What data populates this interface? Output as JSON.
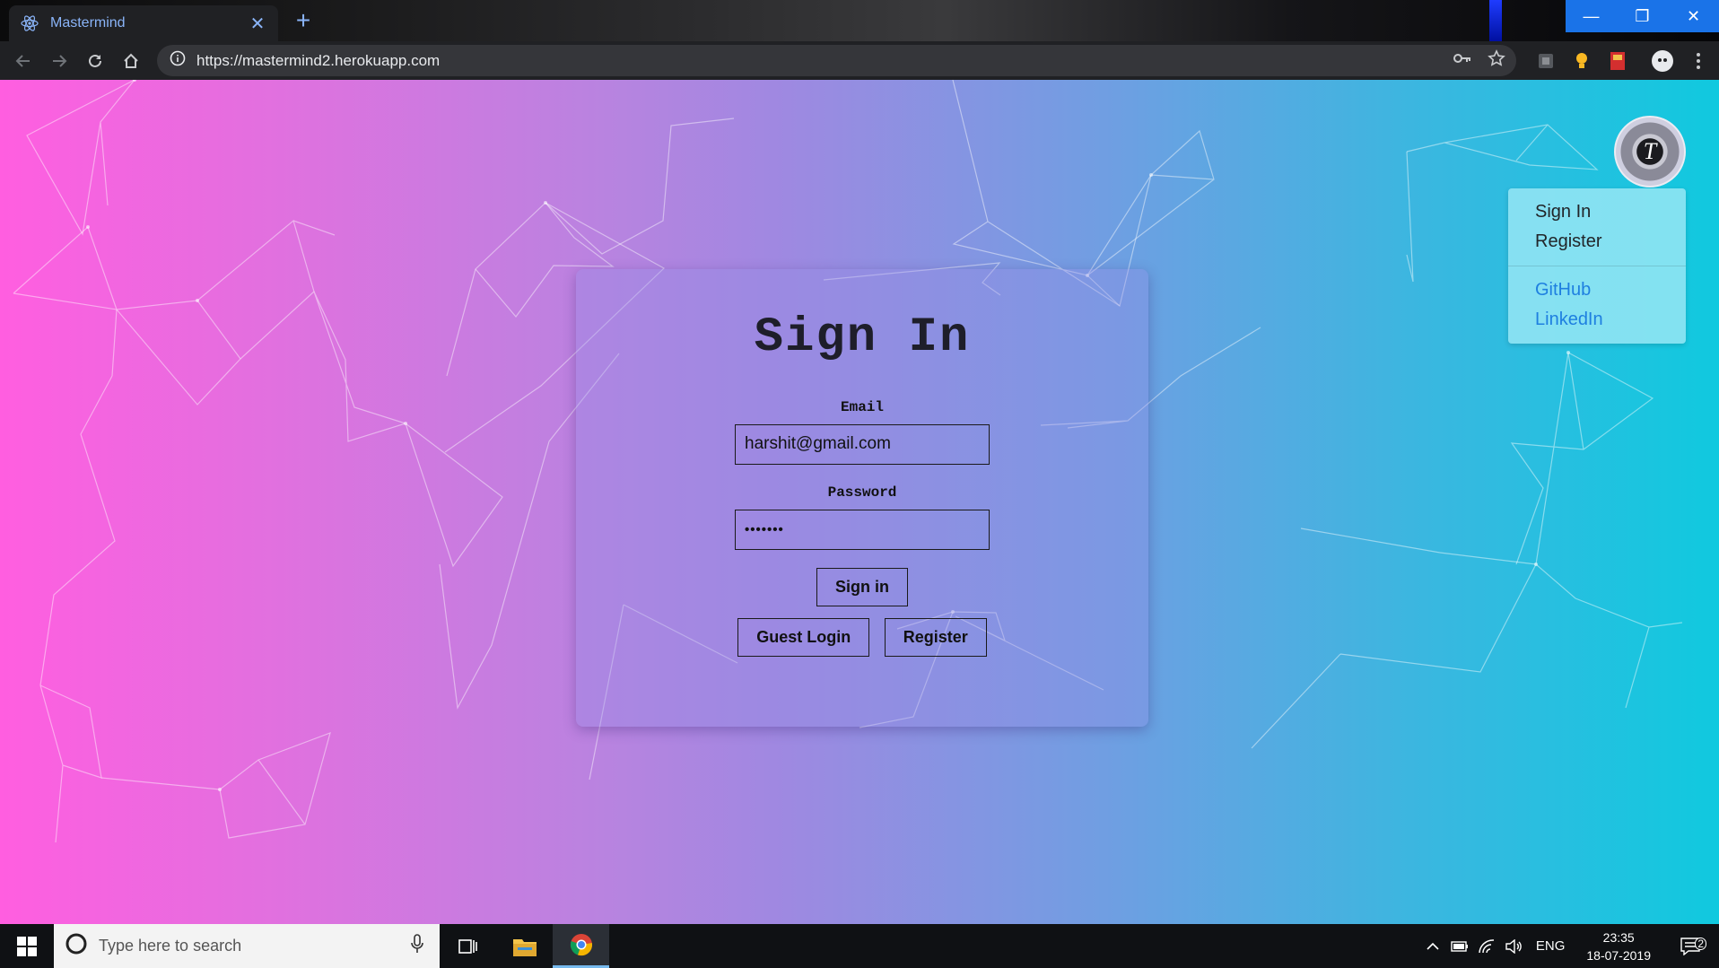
{
  "browser": {
    "tab_title": "Mastermind",
    "tab_close": "✕",
    "new_tab": "+",
    "url": "https://mastermind2.herokuapp.com",
    "window_controls": [
      "—",
      "❐",
      "✕"
    ]
  },
  "signin": {
    "title": "Sign In",
    "email_label": "Email",
    "email_value": "harshit@gmail.com",
    "password_label": "Password",
    "password_value": "•••••••",
    "signin_button": "Sign in",
    "guest_button": "Guest Login",
    "register_button": "Register"
  },
  "avatar": {
    "letter": "T"
  },
  "menu": {
    "items": [
      "Sign In",
      "Register"
    ],
    "links": [
      "GitHub",
      "LinkedIn"
    ]
  },
  "taskbar": {
    "search_placeholder": "Type here to search",
    "language": "ENG",
    "time": "23:35",
    "date": "18-07-2019",
    "notification_count": "2"
  },
  "colors": {
    "gradient_left": "#ff5ee0",
    "gradient_right": "#10c9df",
    "link": "#1e7fe0",
    "chrome_accent": "#1a73e8"
  }
}
